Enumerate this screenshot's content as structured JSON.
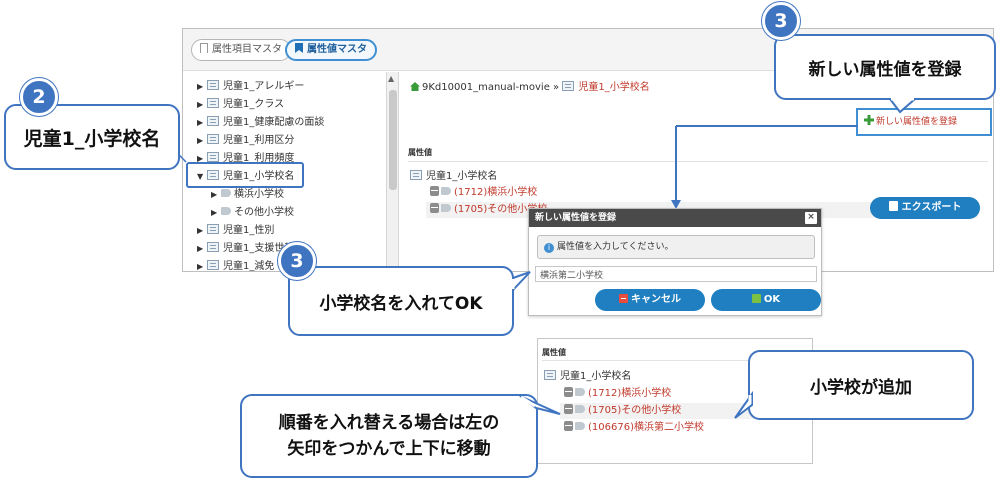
{
  "colors": {
    "accent": "#3f74c0",
    "link_red": "#c0392b",
    "button_blue": "#1f7fc1"
  },
  "tabs": [
    {
      "label": "属性項目マスタ",
      "active": false
    },
    {
      "label": "属性値マスタ",
      "active": true
    }
  ],
  "tree": {
    "items": [
      {
        "label": "児童1_アレルギー",
        "expanded": false
      },
      {
        "label": "児童1_クラス",
        "expanded": false
      },
      {
        "label": "児童1_健康配慮の面談",
        "expanded": false
      },
      {
        "label": "児童1_利用区分",
        "expanded": false
      },
      {
        "label": "児童1_利用頻度",
        "expanded": false
      },
      {
        "label": "児童1_小学校名",
        "expanded": true
      },
      {
        "label": "児童1_性別",
        "expanded": false
      },
      {
        "label": "児童1_支援世帯",
        "expanded": false
      },
      {
        "label": "児童1_減免",
        "expanded": false
      }
    ],
    "children": [
      "横浜小学校",
      "その他小学校"
    ]
  },
  "breadcrumb": {
    "root": "9Kd10001_manual-movie",
    "separator": "»",
    "current": "児童1_小学校名"
  },
  "section_label": "属性値",
  "attribute_name": "児童1_小学校名",
  "values": [
    "(1712)横浜小学校",
    "(1705)その他小学校"
  ],
  "new_value_button": "新しい属性値を登録",
  "export_button": "エクスポート",
  "dialog": {
    "title": "新しい属性値を登録",
    "close": "×",
    "message": "属性値を入力してください。",
    "input_value": "横浜第二小学校",
    "cancel": "キャンセル",
    "ok": "OK"
  },
  "result": {
    "section_label": "属性値",
    "attribute_name": "児童1_小学校名",
    "values": [
      "(1712)横浜小学校",
      "(1705)その他小学校",
      "(106676)横浜第二小学校"
    ]
  },
  "callouts": {
    "step2_badge": "2",
    "step2_text": "児童1_小学校名",
    "step3_badge_top": "3",
    "step3_text_top": "新しい属性値を登録",
    "step3_badge_mid": "3",
    "step3_text_mid": "小学校名を入れてOK",
    "added_text": "小学校が追加",
    "reorder_line1": "順番を入れ替える場合は左の",
    "reorder_line2": "矢印をつかんで上下に移動"
  }
}
